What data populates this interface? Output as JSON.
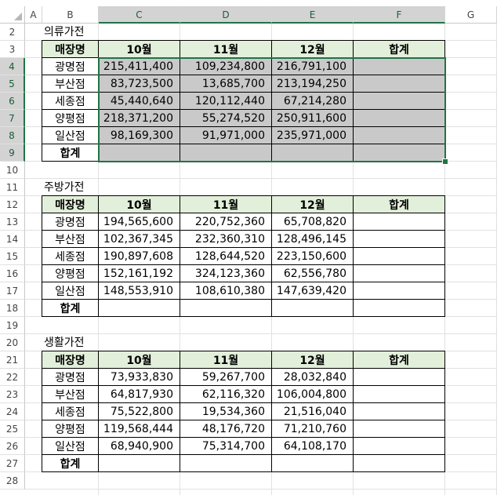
{
  "columns": [
    "A",
    "B",
    "C",
    "D",
    "E",
    "F",
    "G"
  ],
  "rows": [
    "1",
    "2",
    "3",
    "4",
    "5",
    "6",
    "7",
    "8",
    "9",
    "10",
    "11",
    "12",
    "13",
    "14",
    "15",
    "16",
    "17",
    "18",
    "19",
    "20",
    "21",
    "22",
    "23",
    "24",
    "25",
    "26",
    "27",
    "28"
  ],
  "colors": {
    "header_fill": "#e2efda",
    "selection_fill": "#c9c9c9",
    "selection_border": "#217346"
  },
  "tables": [
    {
      "title": "의류가전",
      "headers": [
        "매장명",
        "10월",
        "11월",
        "12월",
        "합계"
      ],
      "rows": [
        {
          "name": "광명점",
          "values": [
            "215,411,400",
            "109,234,800",
            "216,791,100"
          ]
        },
        {
          "name": "부산점",
          "values": [
            "83,723,500",
            "13,685,700",
            "213,194,250"
          ]
        },
        {
          "name": "세종점",
          "values": [
            "45,440,640",
            "120,112,440",
            "67,214,280"
          ]
        },
        {
          "name": "양평점",
          "values": [
            "218,371,200",
            "55,274,520",
            "250,911,600"
          ]
        },
        {
          "name": "일산점",
          "values": [
            "98,169,300",
            "91,971,000",
            "235,971,000"
          ]
        }
      ],
      "total_label": "합계"
    },
    {
      "title": "주방가전",
      "headers": [
        "매장명",
        "10월",
        "11월",
        "12월",
        "합계"
      ],
      "rows": [
        {
          "name": "광명점",
          "values": [
            "194,565,600",
            "220,752,360",
            "65,708,820"
          ]
        },
        {
          "name": "부산점",
          "values": [
            "102,367,345",
            "232,360,310",
            "128,496,145"
          ]
        },
        {
          "name": "세종점",
          "values": [
            "190,897,608",
            "128,644,520",
            "223,150,600"
          ]
        },
        {
          "name": "양평점",
          "values": [
            "152,161,192",
            "324,123,360",
            "62,556,780"
          ]
        },
        {
          "name": "일산점",
          "values": [
            "148,553,910",
            "108,610,380",
            "147,639,420"
          ]
        }
      ],
      "total_label": "합계"
    },
    {
      "title": "생활가전",
      "headers": [
        "매장명",
        "10월",
        "11월",
        "12월",
        "합계"
      ],
      "rows": [
        {
          "name": "광명점",
          "values": [
            "73,933,830",
            "59,267,700",
            "28,032,840"
          ]
        },
        {
          "name": "부산점",
          "values": [
            "64,817,930",
            "62,116,320",
            "106,004,800"
          ]
        },
        {
          "name": "세종점",
          "values": [
            "75,522,800",
            "19,534,360",
            "21,516,040"
          ]
        },
        {
          "name": "양평점",
          "values": [
            "119,568,444",
            "48,176,720",
            "71,210,760"
          ]
        },
        {
          "name": "일산점",
          "values": [
            "68,940,900",
            "75,314,700",
            "64,108,170"
          ]
        }
      ],
      "total_label": "합계"
    }
  ]
}
